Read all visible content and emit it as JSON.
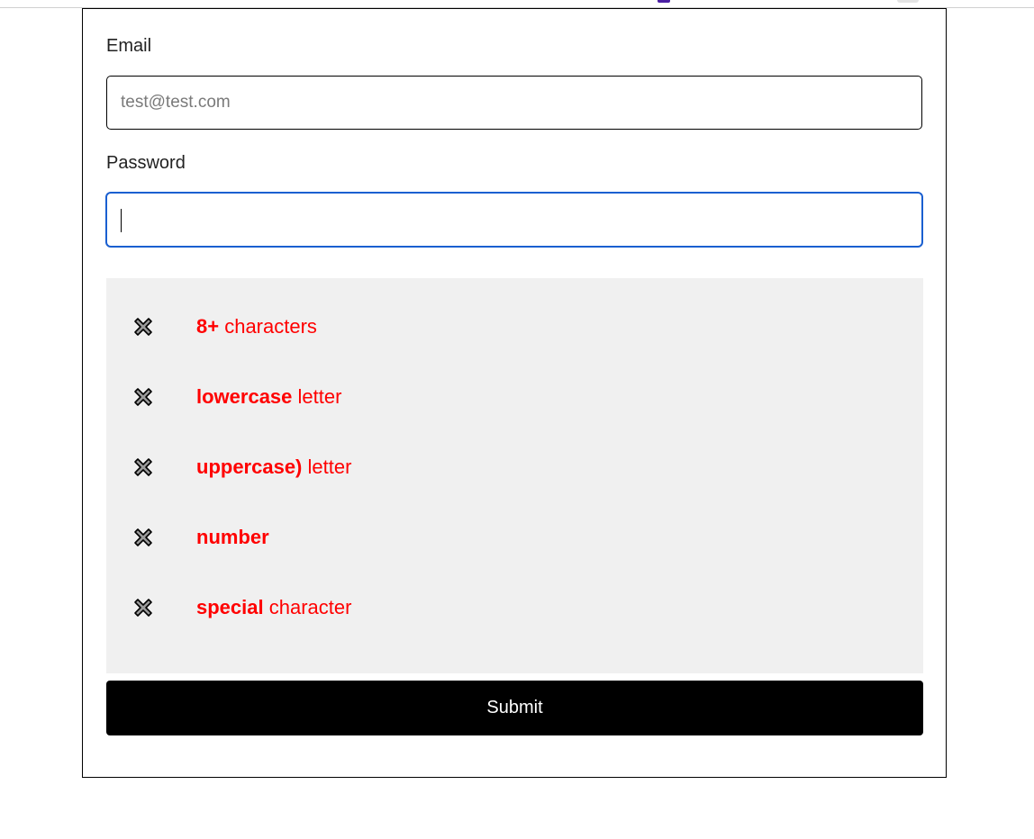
{
  "form": {
    "email": {
      "label": "Email",
      "placeholder": "test@test.com",
      "value": ""
    },
    "password": {
      "label": "Password",
      "value": ""
    },
    "rules": [
      {
        "bold": "8+",
        "text": " characters",
        "icon": "x-mark-icon",
        "met": false
      },
      {
        "bold": "lowercase",
        "text": " letter",
        "icon": "x-mark-icon",
        "met": false
      },
      {
        "bold": "uppercase)",
        "text": " letter",
        "icon": "x-mark-icon",
        "met": false
      },
      {
        "bold": "number",
        "text": "",
        "icon": "x-mark-icon",
        "met": false
      },
      {
        "bold": "special",
        "text": " character",
        "icon": "x-mark-icon",
        "met": false
      }
    ],
    "submit_label": "Submit"
  },
  "colors": {
    "rule_unmet": "#ff0000",
    "rules_background": "#f0f0f0",
    "focus_border": "#1a5fd0",
    "submit_background": "#000000"
  }
}
